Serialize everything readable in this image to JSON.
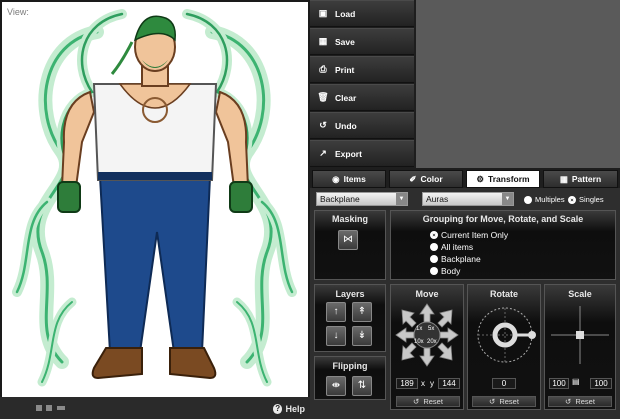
{
  "menu": [
    {
      "label": "Load",
      "icon": "folder-icon"
    },
    {
      "label": "Save",
      "icon": "floppy-icon"
    },
    {
      "label": "Print",
      "icon": "printer-icon"
    },
    {
      "label": "Clear",
      "icon": "trash-icon"
    },
    {
      "label": "Undo",
      "icon": "undo-icon"
    },
    {
      "label": "Export",
      "icon": "export-icon"
    }
  ],
  "tabs": [
    {
      "label": "Items",
      "icon": "cube-icon"
    },
    {
      "label": "Color",
      "icon": "brush-icon"
    },
    {
      "label": "Transform",
      "icon": "gear-icon",
      "active": true
    },
    {
      "label": "Pattern",
      "icon": "checker-icon"
    }
  ],
  "selects": {
    "category": "Backplane",
    "item": "Auras"
  },
  "mode": {
    "multiples": "Multiples",
    "singles": "Singles",
    "selected": "Singles"
  },
  "masking": {
    "title": "Masking"
  },
  "grouping": {
    "title": "Grouping for Move, Rotate, and Scale",
    "options": [
      "Current Item Only",
      "All items",
      "Backplane",
      "Body"
    ],
    "selected": "Current Item Only"
  },
  "layers": {
    "title": "Layers"
  },
  "flipping": {
    "title": "Flipping"
  },
  "move": {
    "title": "Move",
    "steps": [
      "1x",
      "5x",
      "10x",
      "20x"
    ],
    "x": "189",
    "x_label": "x",
    "y_label": "y",
    "y": "144",
    "reset": "Reset"
  },
  "rotate": {
    "title": "Rotate",
    "value": "0",
    "reset": "Reset"
  },
  "scale": {
    "title": "Scale",
    "x": "100",
    "y": "100",
    "reset": "Reset"
  },
  "viewbar": {
    "label": "View:",
    "help": "Help"
  },
  "colors": {
    "accent_green": "#3ab54a",
    "aura_light": "#b8e8c0",
    "panel": "#2e2e2e",
    "preview": "#5a5a5a"
  }
}
